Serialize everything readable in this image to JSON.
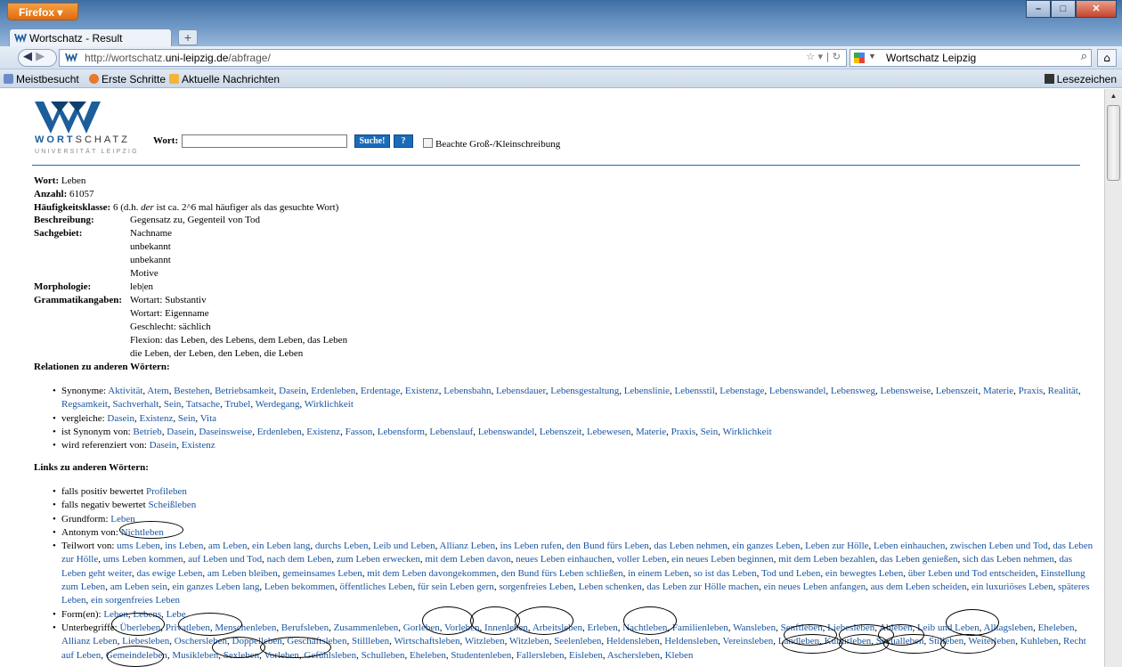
{
  "browser": {
    "app_button": "Firefox",
    "tab_title": "Wortschatz - Result",
    "url_prefix": "http://wortschatz.",
    "url_domain": "uni-leipzig.de",
    "url_path": "/abfrage/",
    "search_engine": "Wortschatz Leipzig",
    "bookmarks": [
      "Meistbesucht",
      "Erste Schritte",
      "Aktuelle Nachrichten"
    ],
    "bookmarks_right": "Lesezeichen"
  },
  "header": {
    "logo_prefix": "WORT",
    "logo_suffix": "SCHATZ",
    "logo_sub": "UNIVERSITÄT LEIPZIG",
    "wort_label": "Wort:",
    "search_button": "Suche!",
    "help_button": "?",
    "case_label": "Beachte Groß-/Kleinschreibung"
  },
  "info": {
    "wort_label": "Wort:",
    "wort": "Leben",
    "anzahl_label": "Anzahl:",
    "anzahl": "61057",
    "hk_label": "Häufigkeitsklasse:",
    "hk_pre": "6 (d.h.",
    "hk_em": "der",
    "hk_post": "ist ca. 2^6 mal häufiger als das gesuchte Wort)",
    "beschreibung_label": "Beschreibung:",
    "beschreibung": "Gegensatz zu, Gegenteil von Tod",
    "sachgebiet_label": "Sachgebiet:",
    "sachgebiet": [
      "Nachname",
      "unbekannt",
      "unbekannt",
      "Motive"
    ],
    "morphologie_label": "Morphologie:",
    "morphologie": "leb|en",
    "grammatik_label": "Grammatikangaben:",
    "grammatik": [
      "Wortart: Substantiv",
      "Wortart: Eigenname",
      "Geschlecht: sächlich",
      "Flexion: das Leben, des Lebens, dem Leben, das Leben",
      "die Leben, der Leben, den Leben, die Leben"
    ]
  },
  "relationen": {
    "title": "Relationen zu anderen Wörtern:",
    "synonyme_label": "Synonyme:",
    "synonyme": [
      "Aktivität",
      "Atem",
      "Bestehen",
      "Betriebsamkeit",
      "Dasein",
      "Erdenleben",
      "Erdentage",
      "Existenz",
      "Lebensbahn",
      "Lebensdauer",
      "Lebensgestaltung",
      "Lebenslinie",
      "Lebensstil",
      "Lebenstage",
      "Lebenswandel",
      "Lebensweg",
      "Lebensweise",
      "Lebenszeit",
      "Materie",
      "Praxis",
      "Realität",
      "Regsamkeit",
      "Sachverhalt",
      "Sein",
      "Tatsache",
      "Trubel",
      "Werdegang",
      "Wirklichkeit"
    ],
    "vergleiche_label": "vergleiche:",
    "vergleiche": [
      "Dasein",
      "Existenz",
      "Sein",
      "Vita"
    ],
    "synonym_von_label": "ist Synonym von:",
    "synonym_von": [
      "Betrieb",
      "Dasein",
      "Daseinsweise",
      "Erdenleben",
      "Existenz",
      "Fasson",
      "Lebensform",
      "Lebenslauf",
      "Lebenswandel",
      "Lebenszeit",
      "Lebewesen",
      "Materie",
      "Praxis",
      "Sein",
      "Wirklichkeit"
    ],
    "referenziert_label": "wird referenziert von:",
    "referenziert": [
      "Dasein",
      "Existenz"
    ]
  },
  "links": {
    "title": "Links zu anderen Wörtern:",
    "positiv_label": "falls positiv bewertet",
    "positiv": "Profileben",
    "negativ_label": "falls negativ bewertet",
    "negativ": "Scheißleben",
    "grundform_label": "Grundform:",
    "grundform": "Leben",
    "antonym_label": "Antonym von:",
    "antonym": "Nichtleben",
    "teilwort_label": "Teilwort von:",
    "teilwort": [
      "ums Leben",
      "ins Leben",
      "am Leben",
      "ein Leben lang",
      "durchs Leben",
      "Leib und Leben",
      "Allianz Leben",
      "ins Leben rufen",
      "den Bund fürs Leben",
      "das Leben nehmen",
      "ein ganzes Leben",
      "Leben zur Hölle",
      "Leben einhauchen",
      "zwischen Leben und Tod",
      "das Leben zur Hölle",
      "ums Leben kommen",
      "auf Leben und Tod",
      "nach dem Leben",
      "zum Leben erwecken",
      "mit dem Leben davon",
      "neues Leben einhauchen",
      "voller Leben",
      "ein neues Leben beginnen",
      "mit dem Leben bezahlen",
      "das Leben genießen",
      "sich das Leben nehmen",
      "das Leben geht weiter",
      "das ewige Leben",
      "am Leben bleiben",
      "gemeinsames Leben",
      "mit dem Leben davongekommen",
      "den Bund fürs Leben schließen",
      "in einem Leben",
      "so ist das Leben",
      "Tod und Leben",
      "ein bewegtes Leben",
      "über Leben und Tod entscheiden",
      "Einstellung zum Leben",
      "am Leben sein",
      "ein ganzes Leben lang",
      "Leben bekommen",
      "öffentliches Leben",
      "für sein Leben gern",
      "sorgenfreies Leben",
      "Leben schenken",
      "das Leben zur Hölle machen",
      "ein neues Leben anfangen",
      "aus dem Leben scheiden",
      "ein luxuriöses Leben",
      "späteres Leben",
      "ein sorgenfreies Leben"
    ],
    "formen_label": "Form(en):",
    "formen": [
      "Leben",
      "Lebens",
      "Lebe"
    ],
    "unterbegriffe_label": "Unterbegriffe:",
    "unterbegriffe": [
      "Überleben",
      "Privatleben",
      "Menschenleben",
      "Berufsleben",
      "Zusammenleben",
      "Gorleben",
      "Vorleben",
      "Innenleben",
      "Arbeitsleben",
      "Erleben",
      "Nachtleben",
      "Familienleben",
      "Wansleben",
      "Senftleben",
      "Liebesleben",
      "Ableben",
      "Leib und Leben",
      "Alltagsleben",
      "Eheleben",
      "Allianz Leben",
      "Liebesleben",
      "Oschersleben",
      "Doppelleben",
      "Geschäftsleben",
      "Stillleben",
      "Wirtschaftsleben",
      "Witzleben",
      "Witzleben",
      "Seelenleben",
      "Heldensleben",
      "Heldensleben",
      "Vereinsleben",
      "Landleben",
      "Kulturleben",
      "Sexualleben",
      "Stilleben",
      "Weiterleben",
      "Kuhleben",
      "Recht auf Leben",
      "Gemeindeleben",
      "Musikleben",
      "Sexleben",
      "Vorleben",
      "Gefühlsleben",
      "Schulleben",
      "Eheleben",
      "Studentenleben",
      "Fallersleben",
      "Eisleben",
      "Aschersleben",
      "Kleben"
    ]
  },
  "colors": {
    "link": "#1a55a0",
    "accent": "#1b6bb8",
    "firefox_orange": "#e06a10"
  }
}
